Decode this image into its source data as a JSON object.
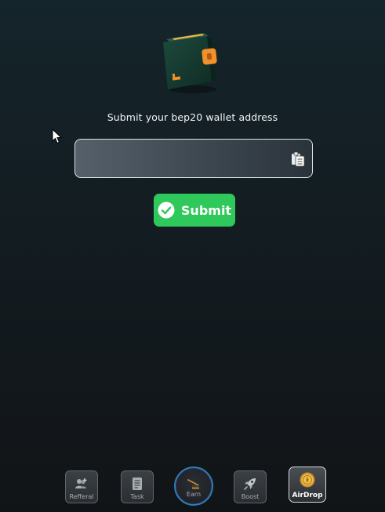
{
  "wallet_form": {
    "prompt": "Submit your bep20 wallet address",
    "address_value": "",
    "submit_label": "Submit"
  },
  "nav": {
    "items": [
      {
        "label": "Refferal",
        "icon": "add-users-icon"
      },
      {
        "label": "Task",
        "icon": "task-list-icon"
      },
      {
        "label": "Earn",
        "icon": "earn-icon"
      },
      {
        "label": "Boost",
        "icon": "rocket-icon"
      },
      {
        "label": "AirDrop",
        "icon": "coin-icon"
      }
    ],
    "active": "AirDrop"
  },
  "colors": {
    "accent_green": "#2fc85a",
    "wallet_body": "#15392f",
    "wallet_clasp": "#f2902a",
    "earn_ring": "#2a7fb4"
  }
}
